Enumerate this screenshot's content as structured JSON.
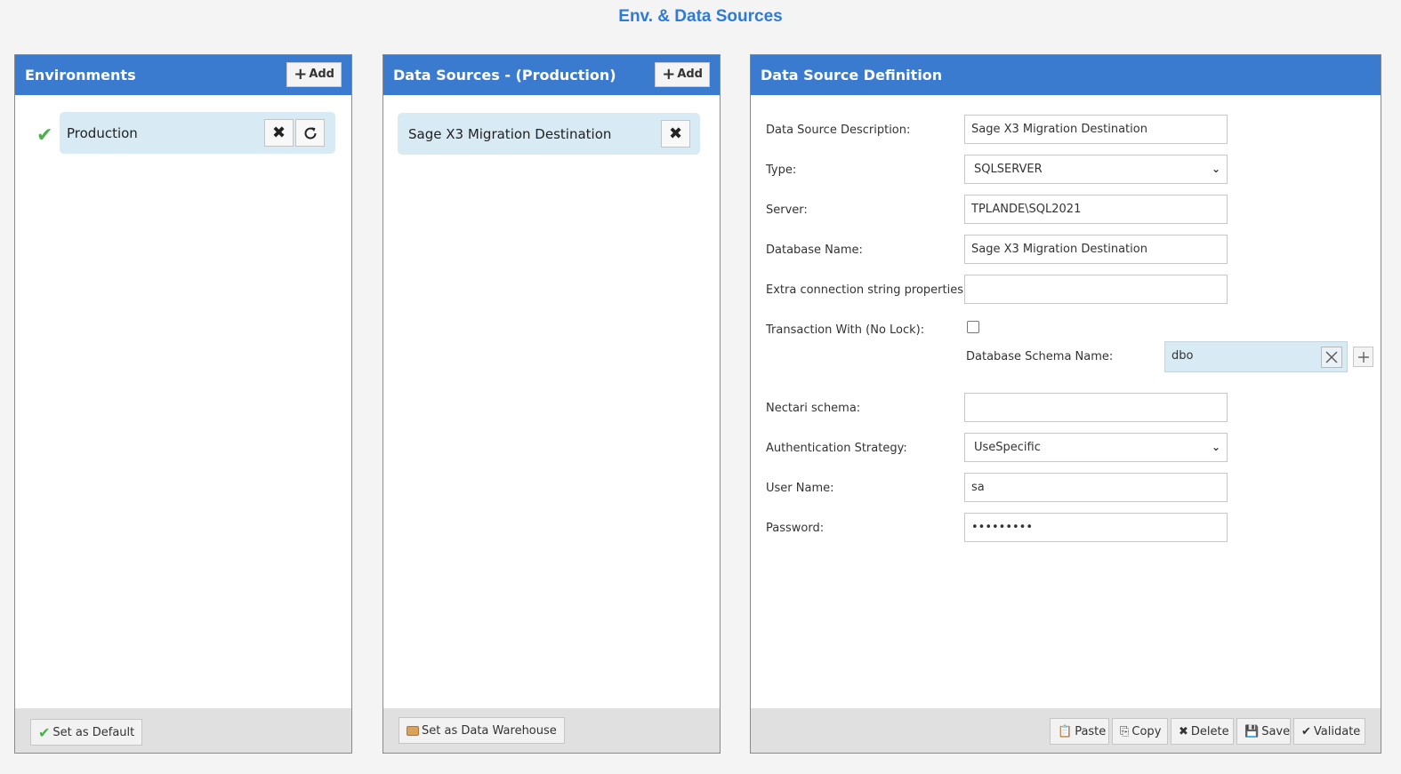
{
  "page": {
    "title": "Env. & Data Sources"
  },
  "environments": {
    "header": "Environments",
    "add_label": "Add",
    "items": [
      {
        "name": "Production",
        "is_default": true
      }
    ],
    "footer": {
      "set_default_label": "Set as Default"
    }
  },
  "data_sources": {
    "header": "Data Sources - (Production)",
    "add_label": "Add",
    "items": [
      {
        "name": "Sage X3 Migration Destination"
      }
    ],
    "footer": {
      "set_warehouse_label": "Set as Data Warehouse"
    }
  },
  "definition": {
    "header": "Data Source Definition",
    "fields": {
      "description": {
        "label": "Data Source Description:",
        "value": "Sage X3 Migration Destination"
      },
      "type": {
        "label": "Type:",
        "value": "SQLSERVER"
      },
      "server": {
        "label": "Server:",
        "value": "TPLANDE\\SQL2021"
      },
      "database": {
        "label": "Database Name:",
        "value": "Sage X3 Migration Destination"
      },
      "extra": {
        "label": "Extra connection string properties:",
        "value": ""
      },
      "nolock": {
        "label": "Transaction With (No Lock):",
        "checked": false
      },
      "schema": {
        "label": "Database Schema Name:",
        "value": "dbo"
      },
      "nectari": {
        "label": "Nectari schema:",
        "value": ""
      },
      "auth": {
        "label": "Authentication Strategy:",
        "value": "UseSpecific"
      },
      "user": {
        "label": "User Name:",
        "value": "sa"
      },
      "password": {
        "label": "Password:",
        "value": "•••••••••"
      }
    },
    "footer": {
      "paste_label": "Paste",
      "copy_label": "Copy",
      "delete_label": "Delete",
      "save_label": "Save",
      "validate_label": "Validate"
    }
  },
  "colors": {
    "header_blue": "#3a7bcf",
    "title_blue": "#2f7bd4",
    "item_bg": "#d8eaf4",
    "check_green": "#4cb04c"
  }
}
